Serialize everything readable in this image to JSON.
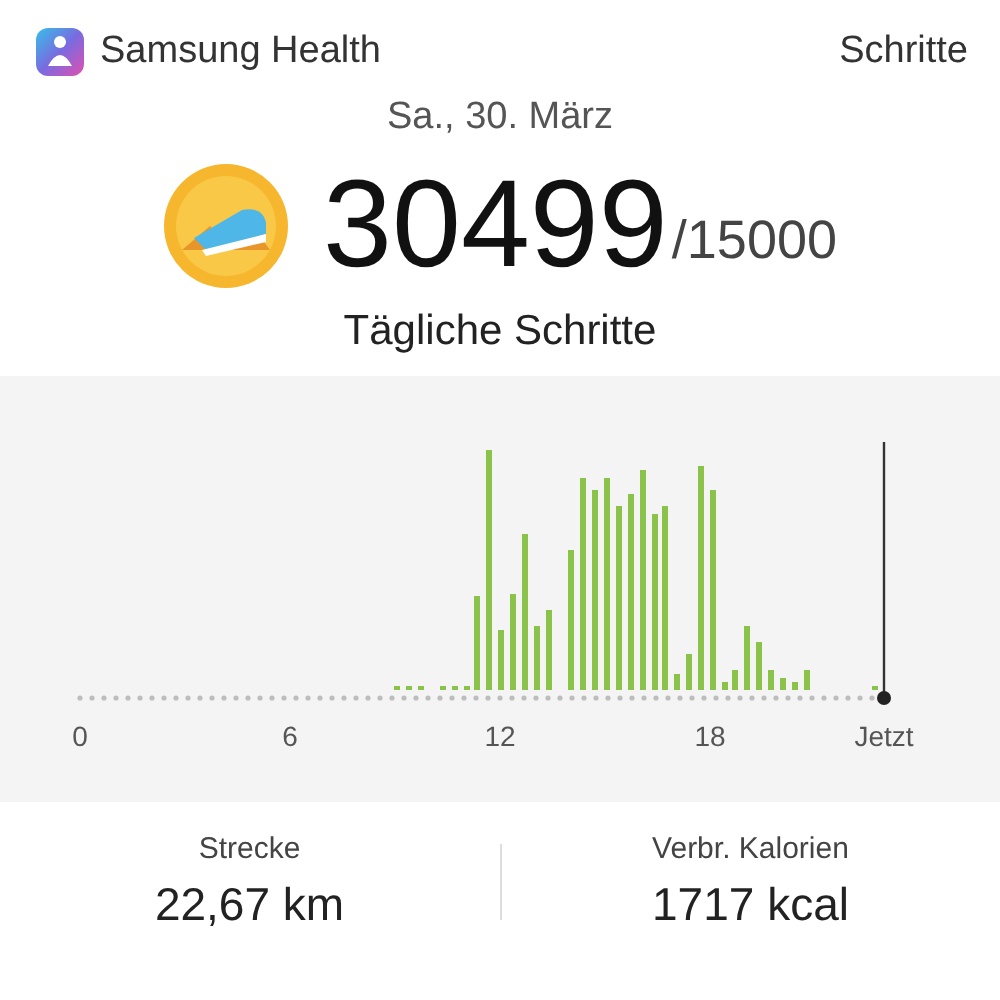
{
  "header": {
    "app_name": "Samsung Health",
    "section": "Schritte"
  },
  "date": "Sa., 30. März",
  "steps": {
    "count": "30499",
    "goal": "/15000",
    "label": "Tägliche Schritte"
  },
  "chart": {
    "x_labels": [
      "0",
      "6",
      "12",
      "18",
      "Jetzt"
    ]
  },
  "stats": [
    {
      "label": "Strecke",
      "value": "22,67 km"
    },
    {
      "label": "Verbr. Kalorien",
      "value": "1717 kcal"
    }
  ]
}
